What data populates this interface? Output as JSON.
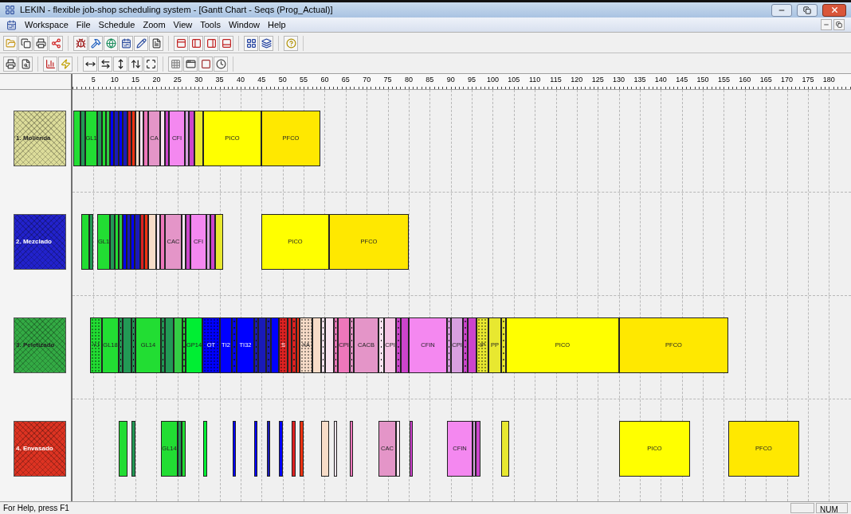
{
  "window": {
    "title": "LEKIN - flexible job-shop scheduling system - [Gantt Chart - Seqs (Prog_Actual)]"
  },
  "menu": [
    "Workspace",
    "File",
    "Schedule",
    "Zoom",
    "View",
    "Tools",
    "Window",
    "Help"
  ],
  "gantt": {
    "ticks": [
      "5",
      "10",
      "15",
      "20",
      "25",
      "30",
      "35",
      "40",
      "45",
      "50",
      "55",
      "60",
      "65",
      "70",
      "75",
      "80",
      "85",
      "90",
      "95",
      "100",
      "105",
      "110",
      "115",
      "120",
      "125",
      "130",
      "135",
      "140",
      "145",
      "150",
      "155",
      "160",
      "165",
      "170",
      "175",
      "180"
    ],
    "machines": [
      {
        "label": "1. Molienda",
        "color": "#dcdc9a",
        "operations": [
          {
            "color": "#22dd33"
          },
          {
            "color": "#229955"
          },
          {
            "color": "#22dd33",
            "label": "GL1"
          },
          {
            "color": "#229955"
          },
          {
            "color": "#22dd33"
          },
          {
            "color": "#33cc44"
          },
          {
            "color": "#0000ff"
          },
          {
            "color": "#1a1ab8"
          },
          {
            "color": "#0000ff"
          },
          {
            "color": "#1a1ab8"
          },
          {
            "color": "#dd2222"
          },
          {
            "color": "#ee3311"
          },
          {
            "color": "#f7dcc8"
          },
          {
            "color": "#f8e4f0"
          },
          {
            "color": "#ee77bb"
          },
          {
            "color": "#e495c8",
            "label": "CA"
          },
          {
            "color": "#f8e4f0"
          },
          {
            "color": "#cc44cc"
          },
          {
            "color": "#f488f0",
            "label": "CFI"
          },
          {
            "color": "#d8a0e0"
          },
          {
            "color": "#cc44cc"
          },
          {
            "color": "#e8e830"
          },
          {
            "color": "#ffff00",
            "label": "PICO"
          },
          {
            "color": "#ffe800",
            "label": "PFCO"
          }
        ]
      },
      {
        "label": "2. Mezclado",
        "color": "#2222cc",
        "operations": [
          {
            "color": "#22dd33"
          },
          {
            "color": "#229955"
          },
          {
            "color": "#22dd33",
            "label": "GL1"
          },
          {
            "color": "#229955"
          },
          {
            "color": "#22dd33"
          },
          {
            "color": "#33cc44"
          },
          {
            "color": "#0000ff"
          },
          {
            "color": "#1a1ab8"
          },
          {
            "color": "#0000ff"
          },
          {
            "color": "#1a1ab8"
          },
          {
            "color": "#dd2222"
          },
          {
            "color": "#ee3311"
          },
          {
            "color": "#f7dcc8"
          },
          {
            "color": "#f8e4f0"
          },
          {
            "color": "#ee77bb"
          },
          {
            "color": "#e495c8",
            "label": "CAC"
          },
          {
            "color": "#f8e4f0"
          },
          {
            "color": "#cc44cc"
          },
          {
            "color": "#f488f0",
            "label": "CFI"
          },
          {
            "color": "#d8a0e0"
          },
          {
            "color": "#cc44cc"
          },
          {
            "color": "#e8e830"
          },
          {
            "color": "#ffff00",
            "label": "PICO"
          },
          {
            "color": "#ffe800",
            "label": "PFCO"
          }
        ]
      },
      {
        "label": "3. Peletizado",
        "color": "#33aa44",
        "operations": [
          {
            "color": "#22dd33",
            "label": "YJ",
            "dotted": true
          },
          {
            "color": "#22dd33",
            "label": "GL18",
            "dotted": false
          },
          {
            "color": "#229955",
            "dotted": true
          },
          {
            "color": "#229955",
            "dotted": false
          },
          {
            "color": "#229955",
            "dotted": true
          },
          {
            "color": "#22dd33",
            "label": "GL14",
            "dotted": false
          },
          {
            "color": "#229955",
            "dotted": true
          },
          {
            "color": "#229955",
            "dotted": false
          },
          {
            "color": "#33cc44",
            "dotted": false
          },
          {
            "color": "#22dd33",
            "dotted": true
          },
          {
            "color": "#00ee33",
            "label": "GP14",
            "dotted": false
          },
          {
            "color": "#0000ff",
            "label": "OT",
            "dotted": true
          },
          {
            "color": "#0000ff",
            "label": "TI2",
            "dotted": false
          },
          {
            "color": "#0000ff",
            "dotted": true
          },
          {
            "color": "#0000ff",
            "label": "TI32",
            "dotted": false
          },
          {
            "color": "#1a1ab8",
            "dotted": true
          },
          {
            "color": "#1a1ab8",
            "dotted": false
          },
          {
            "color": "#1a1ab8",
            "dotted": true
          },
          {
            "color": "#0000ff",
            "dotted": false
          },
          {
            "color": "#dd2222",
            "label": "S",
            "dotted": true
          },
          {
            "color": "#dd2222",
            "dotted": false
          },
          {
            "color": "#dd2222",
            "dotted": true
          },
          {
            "color": "#ee3311",
            "dotted": false
          },
          {
            "color": "#f7dcc8",
            "label": "XA",
            "dotted": true
          },
          {
            "color": "#f7dcc8",
            "dotted": false
          },
          {
            "color": "#f8e4f0",
            "dotted": true
          },
          {
            "color": "#f8e4f0",
            "dotted": false
          },
          {
            "color": "#ee77bb",
            "dotted": true
          },
          {
            "color": "#ee77bb",
            "label": "CPI",
            "dotted": false
          },
          {
            "color": "#e495c8",
            "dotted": true
          },
          {
            "color": "#e495c8",
            "label": "CACB",
            "dotted": false
          },
          {
            "color": "#f8e4f0",
            "dotted": true
          },
          {
            "color": "#f4c4e4",
            "label": "CPI",
            "dotted": false
          },
          {
            "color": "#cc44cc",
            "dotted": true
          },
          {
            "color": "#cc44cc",
            "dotted": false
          },
          {
            "color": "#f488f0",
            "label": "CFIN",
            "dotted": false
          },
          {
            "color": "#d8a0e0",
            "dotted": true
          },
          {
            "color": "#d8a0e0",
            "label": "CPI",
            "dotted": false
          },
          {
            "color": "#cc44cc",
            "dotted": true
          },
          {
            "color": "#cc44cc",
            "dotted": false
          },
          {
            "color": "#e8e830",
            "label": "IP",
            "dotted": true
          },
          {
            "color": "#e8e830",
            "label": "PP",
            "dotted": false
          },
          {
            "color": "#e8e830",
            "dotted": true
          },
          {
            "color": "#ffff00",
            "label": "PICO",
            "dotted": false
          },
          {
            "color": "#ffe800",
            "label": "PFCO",
            "dotted": false
          }
        ]
      },
      {
        "label": "4. Envasado",
        "color": "#dd3322",
        "operations": [
          {
            "color": "#22dd33"
          },
          {
            "color": "#229955"
          },
          {
            "color": "#22dd33",
            "label": "GL14"
          },
          {
            "color": "#229955"
          },
          {
            "color": "#22dd33"
          },
          {
            "color": "#00ee33"
          },
          {
            "color": "#0000ff"
          },
          {
            "color": "#0000ff"
          },
          {
            "color": "#1a1ab8"
          },
          {
            "color": "#0000ff"
          },
          {
            "color": "#dd2222"
          },
          {
            "color": "#ee3311"
          },
          {
            "color": "#f7dcc8"
          },
          {
            "color": "#f8e4f0"
          },
          {
            "color": "#ee77bb"
          },
          {
            "color": "#e495c8",
            "label": "CAC"
          },
          {
            "color": "#f8e4f0"
          },
          {
            "color": "#cc44cc"
          },
          {
            "color": "#f488f0",
            "label": "CFIN"
          },
          {
            "color": "#d8a0e0"
          },
          {
            "color": "#cc44cc"
          },
          {
            "color": "#e8e830"
          },
          {
            "color": "#ffff00",
            "label": "PICO"
          },
          {
            "color": "#ffe800",
            "label": "PFCO"
          }
        ]
      }
    ]
  },
  "status_bar": {
    "text": "For Help, press F1",
    "indicator": "NUM"
  }
}
